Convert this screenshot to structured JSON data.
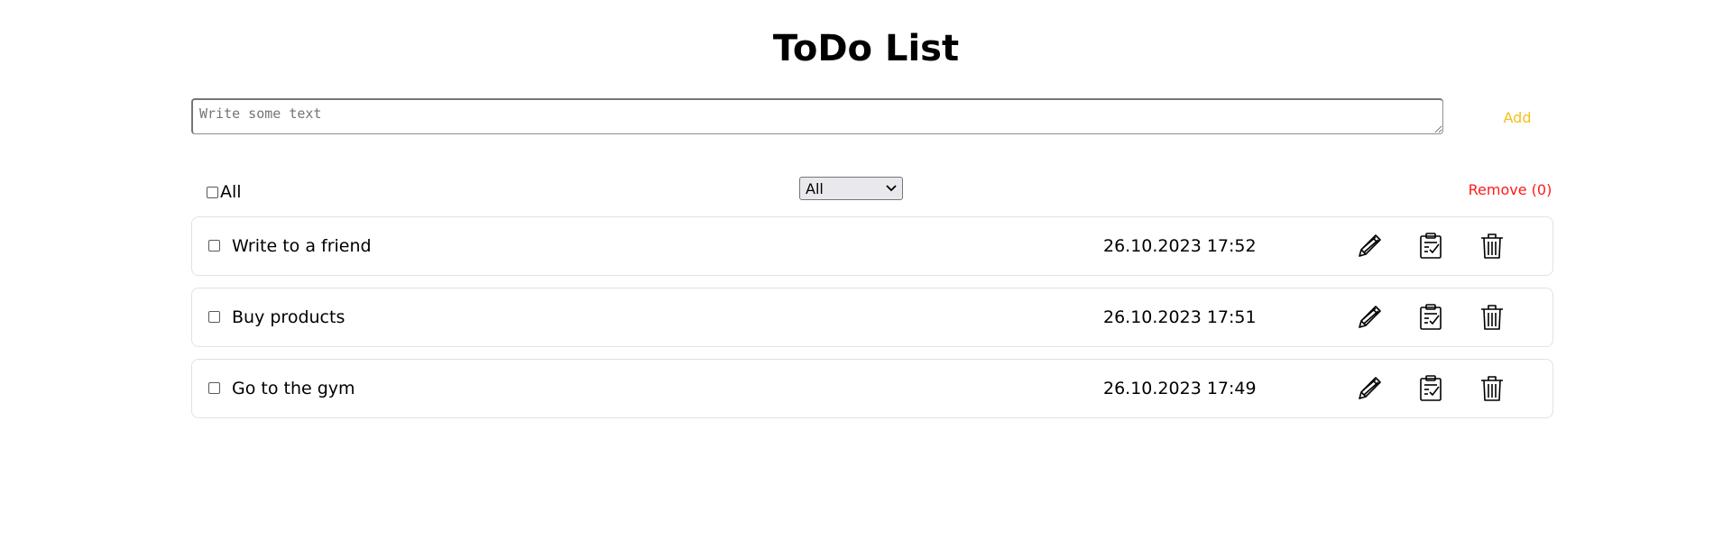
{
  "header": {
    "title": "ToDo List"
  },
  "new_todo": {
    "placeholder": "Write some text",
    "value": "",
    "add_label": "Add"
  },
  "controls": {
    "select_all_label": "All",
    "filter_selected": "All",
    "remove_label": "Remove (0)"
  },
  "todos": [
    {
      "text": "Write to a friend",
      "date": "26.10.2023 17:52",
      "checked": false
    },
    {
      "text": "Buy products",
      "date": "26.10.2023 17:51",
      "checked": false
    },
    {
      "text": "Go to the gym",
      "date": "26.10.2023 17:49",
      "checked": false
    }
  ],
  "icons": {
    "edit": "pencil-icon",
    "complete": "clipboard-check-icon",
    "delete": "trash-icon"
  },
  "colors": {
    "add": "#f4c01a",
    "remove": "#ff1a1a",
    "item_border": "#e2e2e2"
  }
}
